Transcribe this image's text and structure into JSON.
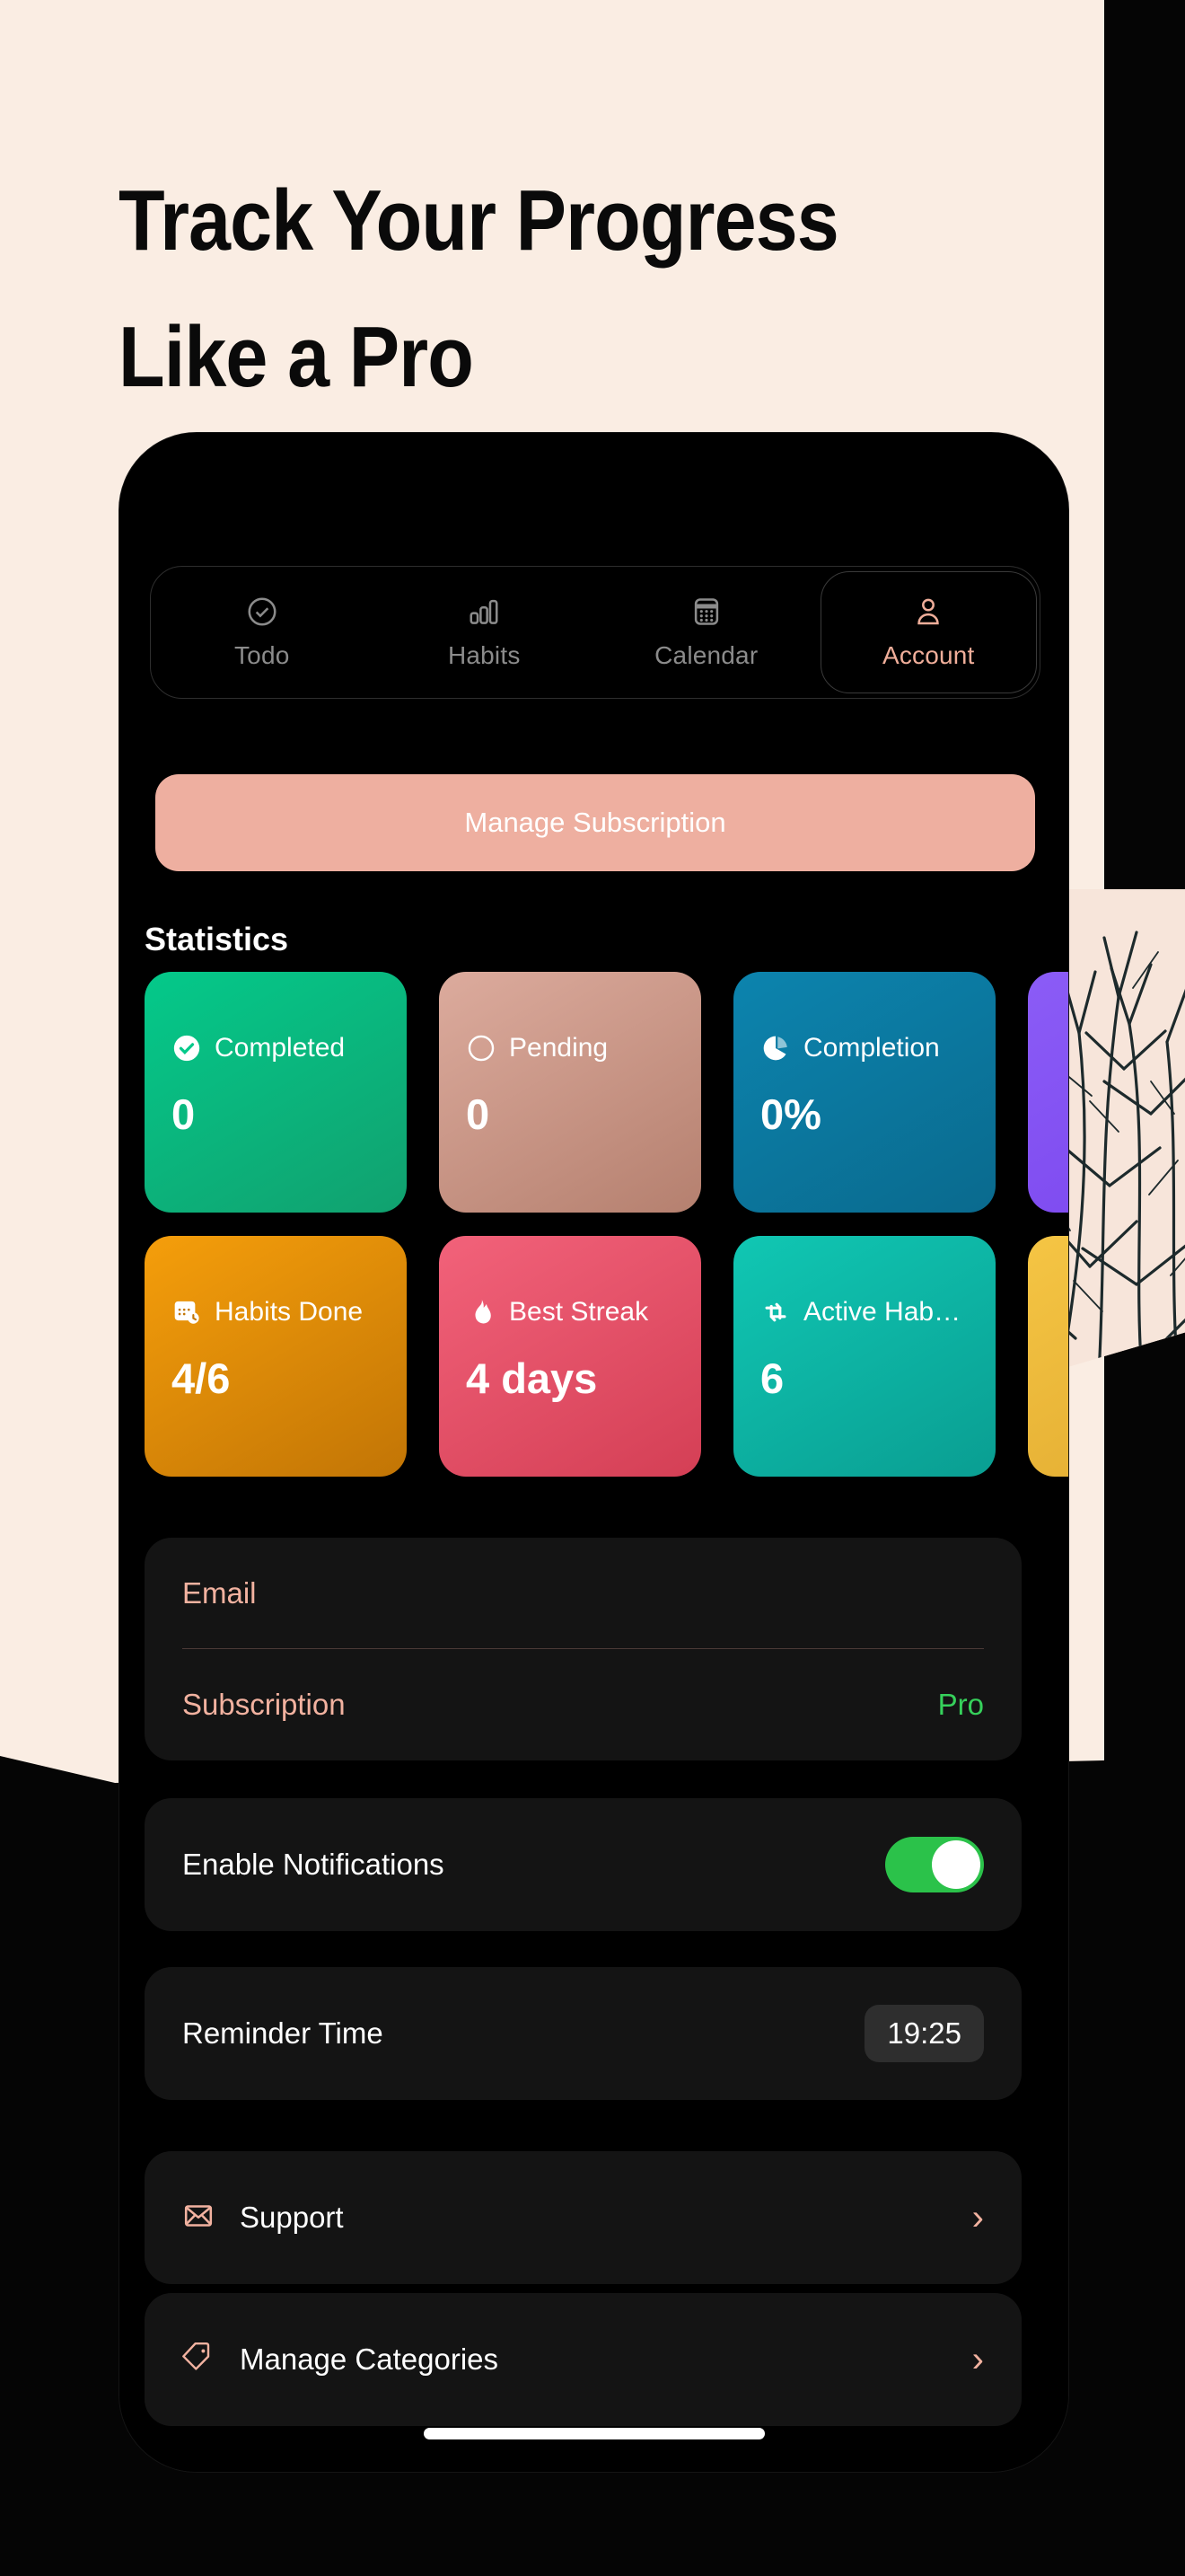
{
  "hero": {
    "line1": "Track Your Progress",
    "line2": "Like a Pro"
  },
  "colors": {
    "cream_background": "#FAEDE3",
    "accent_salmon": "#F0AE9A",
    "subscribe_button": "#EEAFA0",
    "pro_green": "#36D15B",
    "toggle_on": "#2BC24A"
  },
  "tabs": [
    {
      "label": "Todo",
      "icon": "check-circle-icon",
      "active": false
    },
    {
      "label": "Habits",
      "icon": "bar-chart-icon",
      "active": false
    },
    {
      "label": "Calendar",
      "icon": "calendar-icon",
      "active": false
    },
    {
      "label": "Account",
      "icon": "person-icon",
      "active": true
    }
  ],
  "subscription_button": {
    "label": "Manage Subscription"
  },
  "statistics": {
    "title": "Statistics",
    "cards": [
      {
        "label": "Completed",
        "value": "0",
        "icon": "check-filled-icon",
        "color_from": "#04C98A",
        "color_to": "#12A96F"
      },
      {
        "label": "Pending",
        "value": "0",
        "icon": "circle-outline-icon",
        "color_from": "#D9A596",
        "color_to": "#B98271"
      },
      {
        "label": "Completion",
        "value": "0%",
        "icon": "pie-chart-icon",
        "color_from": "#0B7FA8",
        "color_to": "#0A6E93"
      },
      {
        "label": "",
        "value": "",
        "icon": "partial-card-icon",
        "color_from": "#8B5CF6",
        "color_to": "#7C4DEF"
      },
      {
        "label": "Habits Done",
        "value": "4/6",
        "icon": "calendar-clock-icon",
        "color_from": "#F59E0B",
        "color_to": "#C97706"
      },
      {
        "label": "Best Streak",
        "value": "4 days",
        "icon": "flame-icon",
        "color_from": "#F05A6E",
        "color_to": "#D94055"
      },
      {
        "label": "Active Hab…",
        "value": "6",
        "icon": "repeat-icon",
        "color_from": "#0FC2B0",
        "color_to": "#0AA99B"
      },
      {
        "label": "",
        "value": "",
        "icon": "partial-card-icon",
        "color_from": "#F4C040",
        "color_to": "#E0A92F"
      }
    ]
  },
  "account_info": {
    "email_label": "Email",
    "email_value": "",
    "subscription_label": "Subscription",
    "subscription_value": "Pro"
  },
  "settings": {
    "notifications_label": "Enable Notifications",
    "notifications_enabled": "on",
    "reminder_label": "Reminder Time",
    "reminder_time": "19:25",
    "support_label": "Support",
    "support_icon": "envelope-icon",
    "categories_label": "Manage Categories",
    "categories_icon": "tag-icon",
    "chevron": "›"
  }
}
